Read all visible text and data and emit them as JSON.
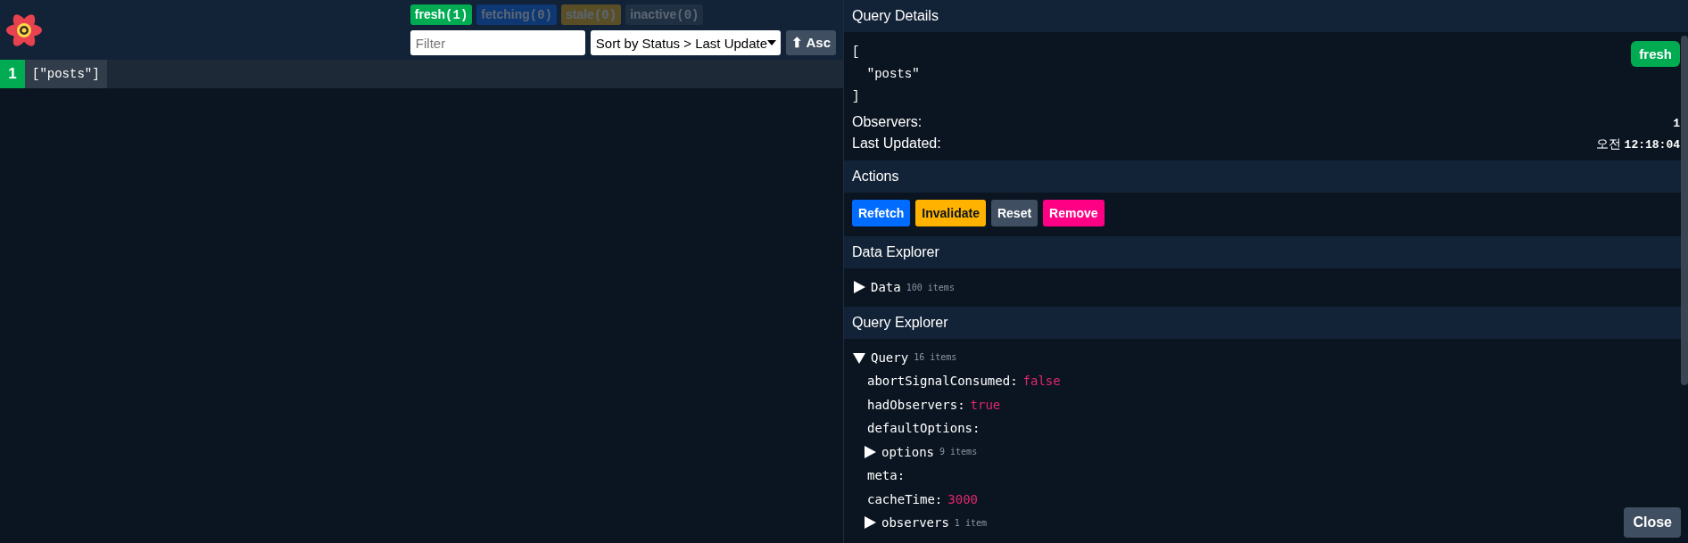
{
  "filters": [
    {
      "kind": "fresh",
      "label": "fresh",
      "count": "(1)",
      "disabled": false
    },
    {
      "kind": "fetching",
      "label": "fetching",
      "count": "(0)",
      "disabled": true
    },
    {
      "kind": "stale",
      "label": "stale",
      "count": "(0)",
      "disabled": true
    },
    {
      "kind": "inactive",
      "label": "inactive",
      "count": "(0)",
      "disabled": true
    }
  ],
  "filter_field": {
    "placeholder": "Filter"
  },
  "sort_select": {
    "value": "Sort by Status > Last Update"
  },
  "sort_direction": {
    "label": "⬆ Asc"
  },
  "queries": [
    {
      "observers": "1",
      "key": "[\"posts\"]"
    }
  ],
  "details": {
    "title": "Query Details",
    "key_lines": [
      "[",
      "  \"posts\"",
      "]"
    ],
    "status": "fresh",
    "rows": [
      {
        "label": "Observers:",
        "value": "1"
      },
      {
        "label": "Last Updated:",
        "prefix": "오전",
        "value": "12:18:04"
      }
    ]
  },
  "actions": {
    "title": "Actions",
    "buttons": [
      {
        "kind": "refetch",
        "label": "Refetch"
      },
      {
        "kind": "invalidate",
        "label": "Invalidate"
      },
      {
        "kind": "reset",
        "label": "Reset"
      },
      {
        "kind": "remove",
        "label": "Remove"
      }
    ]
  },
  "data_explorer": {
    "title": "Data Explorer",
    "entries": [
      {
        "kind": "node",
        "label": "Data",
        "count": "100 items",
        "expanded": false
      }
    ]
  },
  "query_explorer": {
    "title": "Query Explorer",
    "entries": [
      {
        "kind": "node",
        "label": "Query",
        "count": "16 items",
        "expanded": true,
        "children": [
          {
            "kind": "pair",
            "label": "abortSignalConsumed:",
            "value": "false"
          },
          {
            "kind": "pair",
            "label": "hadObservers:",
            "value": "true"
          },
          {
            "kind": "key",
            "label": "defaultOptions:"
          },
          {
            "kind": "node",
            "label": "options",
            "count": "9 items",
            "expanded": false
          },
          {
            "kind": "key",
            "label": "meta:"
          },
          {
            "kind": "pair",
            "label": "cacheTime:",
            "value": "3000"
          },
          {
            "kind": "node",
            "label": "observers",
            "count": "1 item",
            "expanded": false
          }
        ]
      }
    ]
  },
  "close_button": {
    "label": "Close"
  }
}
